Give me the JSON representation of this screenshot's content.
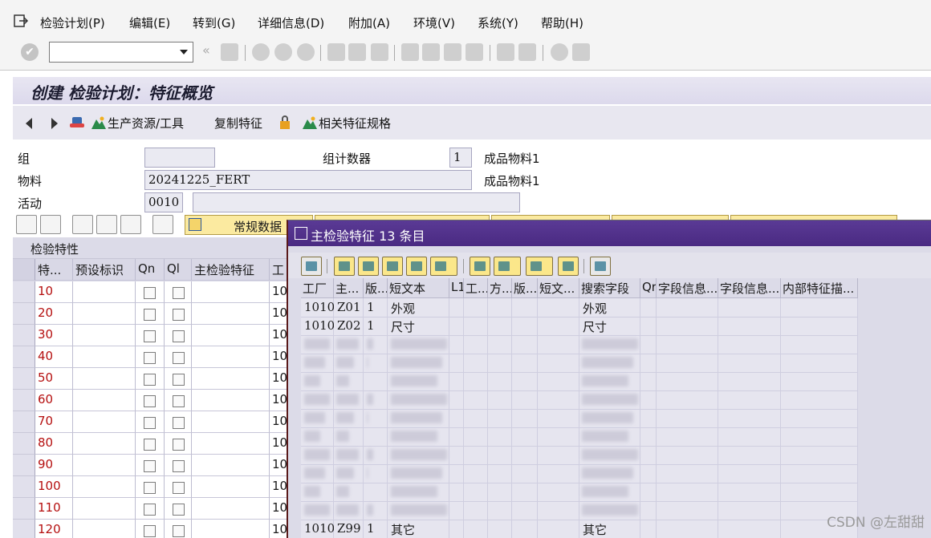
{
  "menu": {
    "items": [
      "检验计划(P)",
      "编辑(E)",
      "转到(G)",
      "详细信息(D)",
      "附加(A)",
      "环境(V)",
      "系统(Y)",
      "帮助(H)"
    ]
  },
  "toolbar": {
    "command_value": ""
  },
  "title": "创建 检验计划：特征概览",
  "app_toolbar": {
    "production_resources": "生产资源/工具",
    "copy_characteristic": "复制特征",
    "related_spec": "相关特征规格"
  },
  "header": {
    "group_label": "组",
    "group_value": "",
    "group_counter_label": "组计数器",
    "group_counter_value": "1",
    "group_text": "成品物料1",
    "material_label": "物料",
    "material_value": "20241225_FERT",
    "material_text": "成品物料1",
    "activity_label": "活动",
    "activity_value": "0010",
    "activity_desc": ""
  },
  "tabs": {
    "general_data": "常规数据"
  },
  "grid": {
    "title": "检验特性",
    "columns": [
      "特...",
      "预设标识",
      "Qn",
      "Ql",
      "主检验特征",
      "工"
    ],
    "rows": [
      {
        "no": "10",
        "plant": "10"
      },
      {
        "no": "20",
        "plant": "10"
      },
      {
        "no": "30",
        "plant": "10"
      },
      {
        "no": "40",
        "plant": "10"
      },
      {
        "no": "50",
        "plant": "10"
      },
      {
        "no": "60",
        "plant": "10"
      },
      {
        "no": "70",
        "plant": "10"
      },
      {
        "no": "80",
        "plant": "10"
      },
      {
        "no": "90",
        "plant": "10"
      },
      {
        "no": "100",
        "plant": "10"
      },
      {
        "no": "110",
        "plant": "10"
      },
      {
        "no": "120",
        "plant": "10"
      }
    ]
  },
  "popup": {
    "title": "主检验特征 13 条目",
    "columns": [
      "工厂",
      "主...",
      "版...",
      "短文本",
      "L1",
      "工...",
      "方...",
      "版...",
      "短文...",
      "搜索字段",
      "Qr",
      "字段信息...",
      "字段信息...",
      "内部特征描..."
    ],
    "rows": [
      {
        "plant": "1010",
        "mic": "Z01",
        "ver": "1",
        "short": "外观",
        "search": "外观"
      },
      {
        "plant": "1010",
        "mic": "Z02",
        "ver": "1",
        "short": "尺寸",
        "search": "尺寸"
      },
      {
        "plant": "1010",
        "mic": "Z99",
        "ver": "1",
        "short": "其它",
        "search": "其它"
      }
    ]
  },
  "watermark": "CSDN @左甜甜"
}
